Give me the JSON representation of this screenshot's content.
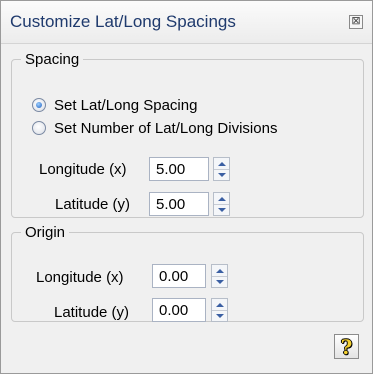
{
  "window": {
    "title": "Customize Lat/Long Spacings",
    "close_glyph": "⊠"
  },
  "spacing_group": {
    "legend": "Spacing",
    "radios": [
      {
        "label": "Set Lat/Long Spacing",
        "checked": true
      },
      {
        "label": "Set Number of Lat/Long Divisions",
        "checked": false
      }
    ],
    "longitude": {
      "label": "Longitude (x)",
      "value": "5.00"
    },
    "latitude": {
      "label": "Latitude (y)",
      "value": "5.00"
    }
  },
  "origin_group": {
    "legend": "Origin",
    "longitude": {
      "label": "Longitude (x)",
      "value": "0.00"
    },
    "latitude": {
      "label": "Latitude (y)",
      "value": "0.00"
    }
  },
  "help_button": {
    "glyph": "?",
    "icon": "help-icon"
  },
  "colors": {
    "title_text": "#1f3a6d",
    "dialog_bg": "#f0f0f0",
    "spinner_arrow": "#3a5fa3",
    "help_icon": "#f2cf2f"
  }
}
